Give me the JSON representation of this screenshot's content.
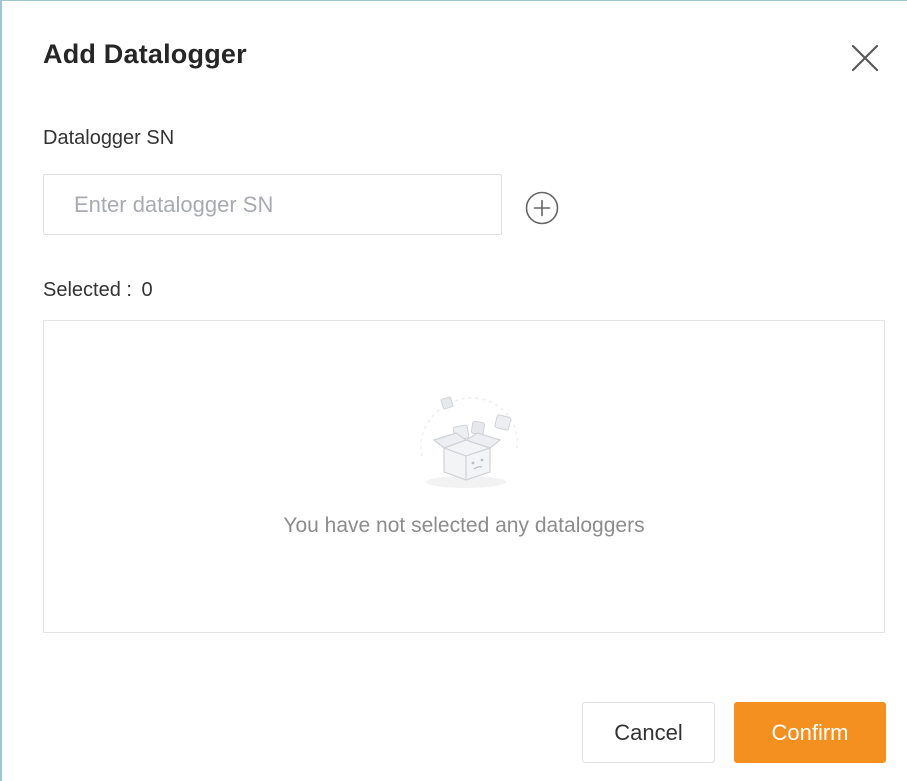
{
  "dialog": {
    "title": "Add Datalogger",
    "close_icon": "close-icon"
  },
  "form": {
    "sn_label": "Datalogger SN",
    "sn_value": "",
    "sn_placeholder": "Enter datalogger SN",
    "add_icon": "plus-circle-icon"
  },
  "selection": {
    "label": "Selected :",
    "count": "0",
    "empty_icon": "empty-box-icon",
    "empty_message": "You have not selected any dataloggers"
  },
  "footer": {
    "cancel_label": "Cancel",
    "confirm_label": "Confirm"
  },
  "colors": {
    "primary": "#f39020",
    "border": "#dcdfe6",
    "title_text": "#262626",
    "muted_text": "#8c8c8c",
    "frame": "#9fc7d1"
  }
}
